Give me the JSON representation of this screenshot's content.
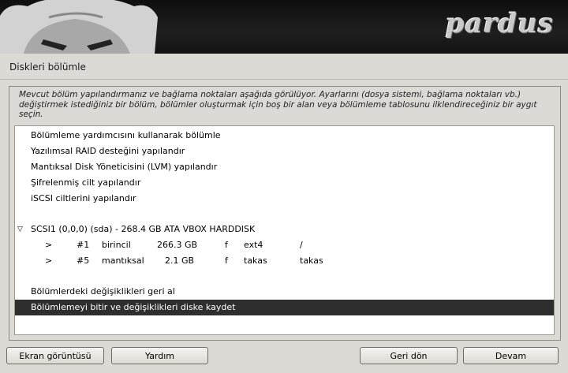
{
  "window": {
    "title": "Diskleri bölümle",
    "logo_text": "pardus"
  },
  "description": "Mevcut bölüm yapılandırmanız ve bağlama noktaları aşağıda görülüyor. Ayarlarını (dosya sistemi, bağlama noktaları vb.) değiştirmek istediğiniz bir bölüm, bölümler oluşturmak için boş bir alan veya bölümleme tablosunu ilklendireceğiniz bir aygıt seçin.",
  "list": {
    "options": [
      "Bölümleme yardımcısını kullanarak bölümle",
      "Yazılımsal RAID desteğini yapılandır",
      "Mantıksal Disk Yöneticisini (LVM) yapılandır",
      "Şifrelenmiş cilt yapılandır",
      "iSCSI ciltlerini yapılandır"
    ],
    "disk": {
      "expand_symbol": "▽",
      "label": "SCSI1 (0,0,0) (sda) - 268.4 GB ATA VBOX HARDDISK"
    },
    "partitions": [
      {
        "arrow": ">",
        "number": "#1",
        "type": "birincil",
        "size": "266.3 GB",
        "flag": "f",
        "fs": "ext4",
        "mount": "/"
      },
      {
        "arrow": ">",
        "number": "#5",
        "type": "mantıksal",
        "size": "2.1 GB",
        "flag": "f",
        "fs": "takas",
        "mount": "takas"
      }
    ],
    "undo": "Bölümlerdeki değişiklikleri geri al",
    "finish": "Bölümlemeyi bitir ve değişiklikleri diske kaydet"
  },
  "buttons": {
    "screenshot": "Ekran görüntüsü",
    "help": "Yardım",
    "back": "Geri dön",
    "continue": "Devam"
  }
}
